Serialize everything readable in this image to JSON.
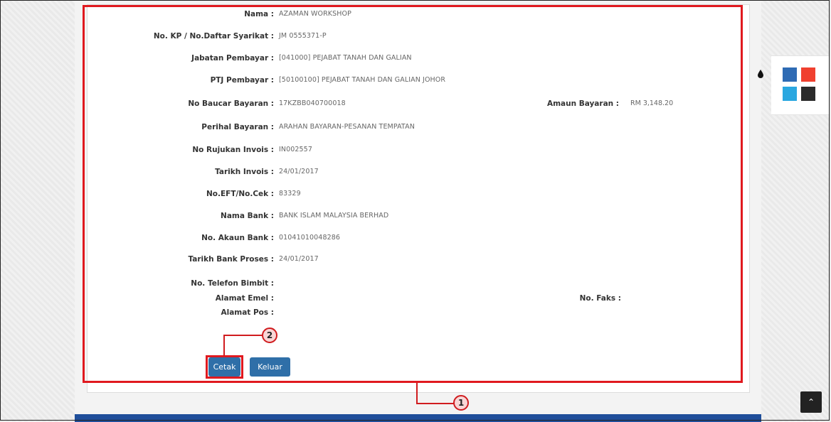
{
  "details": {
    "nama": {
      "label": "Nama :",
      "value": "AZAMAN WORKSHOP"
    },
    "no_kp": {
      "label": "No. KP / No.Daftar Syarikat :",
      "value": "JM 0555371-P"
    },
    "jabatan": {
      "label": "Jabatan Pembayar :",
      "value": "[041000] PEJABAT TANAH DAN GALIAN"
    },
    "ptj": {
      "label": "PTJ Pembayar :",
      "value": "[50100100] PEJABAT TANAH DAN GALIAN JOHOR"
    },
    "baucar": {
      "label": "No Baucar Bayaran :",
      "value": "17KZBB040700018"
    },
    "amaun": {
      "label": "Amaun Bayaran :",
      "value": "RM  3,148.20"
    },
    "perihal": {
      "label": "Perihal Bayaran :",
      "value": "ARAHAN BAYARAN-PESANAN TEMPATAN"
    },
    "rujukan": {
      "label": "No Rujukan Invois :",
      "value": "IN002557"
    },
    "tarikh_invois": {
      "label": "Tarikh Invois :",
      "value": "24/01/2017"
    },
    "eft": {
      "label": "No.EFT/No.Cek :",
      "value": "83329"
    },
    "nama_bank": {
      "label": "Nama Bank :",
      "value": "BANK ISLAM MALAYSIA BERHAD"
    },
    "akaun": {
      "label": "No. Akaun Bank :",
      "value": "01041010048286"
    },
    "tarikh_bank": {
      "label": "Tarikh Bank Proses :",
      "value": "24/01/2017"
    },
    "telefon": {
      "label": "No. Telefon Bimbit :",
      "value": ""
    },
    "emel": {
      "label": "Alamat Emel :",
      "value": ""
    },
    "faks": {
      "label": "No. Faks :",
      "value": ""
    },
    "pos": {
      "label": "Alamat Pos :",
      "value": ""
    }
  },
  "buttons": {
    "cetak": "Cetak",
    "keluar": "Keluar"
  },
  "callouts": {
    "one": "1",
    "two": "2"
  },
  "icons": {
    "drop": "ink-drop-icon",
    "scroll_top": "chevron-up-icon"
  },
  "colors": {
    "highlight": "#e0191f",
    "button": "#2f6fa8",
    "bottom_bar": "#1f4e9a",
    "swatches": [
      "#2e6bb4",
      "#f0402f",
      "#2aa7e0",
      "#2b2b2b"
    ]
  },
  "glyphs": {
    "scroll_top": "⌃"
  }
}
